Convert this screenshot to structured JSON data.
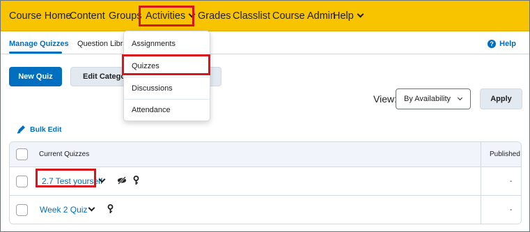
{
  "nav": {
    "items": [
      {
        "label": "Course Home",
        "has_menu": false
      },
      {
        "label": "Content",
        "has_menu": false
      },
      {
        "label": "Groups",
        "has_menu": false
      },
      {
        "label": "Activities",
        "has_menu": true
      },
      {
        "label": "Grades",
        "has_menu": false
      },
      {
        "label": "Classlist",
        "has_menu": false
      },
      {
        "label": "Course Admin",
        "has_menu": false
      },
      {
        "label": "Help",
        "has_menu": true
      }
    ]
  },
  "activities_menu": {
    "items": [
      "Assignments",
      "Quizzes",
      "Discussions",
      "Attendance"
    ]
  },
  "tabs": {
    "manage_quizzes": "Manage Quizzes",
    "question_library": "Question Libra"
  },
  "help_link": {
    "label": "Help",
    "icon": "?"
  },
  "toolbar": {
    "new_quiz": "New Quiz",
    "edit_categories": "Edit Categorie"
  },
  "view": {
    "label": "View:",
    "selected": "By Availability",
    "apply": "Apply"
  },
  "bulk_edit": {
    "label": "Bulk Edit",
    "icon": "pencil-icon"
  },
  "table": {
    "columns": [
      "Current Quizzes",
      "Published"
    ],
    "rows": [
      {
        "name": "2.7 Test yourself",
        "published": "-",
        "icons": [
          "hidden-eye-icon",
          "pin-icon"
        ]
      },
      {
        "name": "Week 2 Quiz",
        "published": "-",
        "icons": [
          "pin-icon"
        ]
      }
    ]
  },
  "colors": {
    "nav_bg": "#f8c400",
    "accent": "#006fbf",
    "highlight": "#d9141c"
  }
}
